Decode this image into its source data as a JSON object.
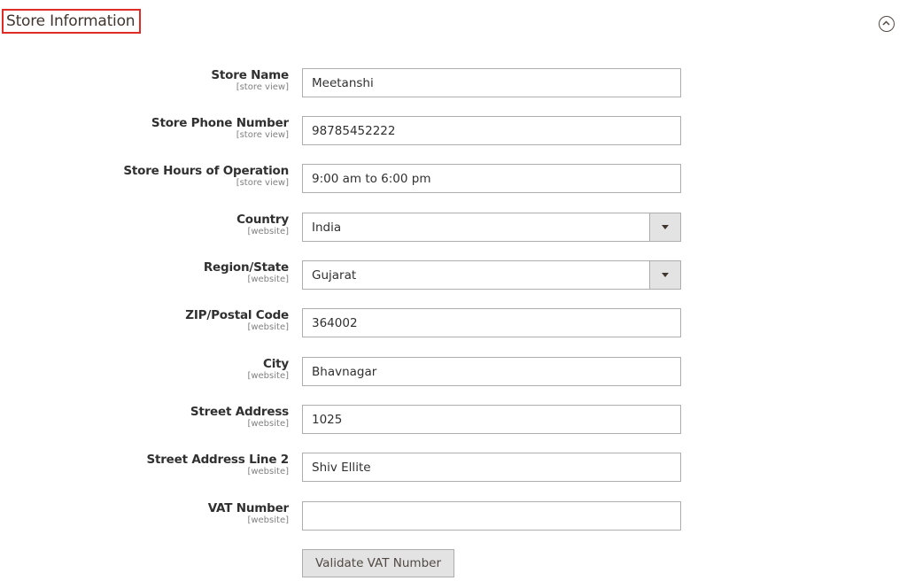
{
  "section": {
    "title": "Store Information",
    "collapse_icon": "chevron-up-circle-icon"
  },
  "fields": [
    {
      "label": "Store Name",
      "scope": "[store view]",
      "type": "text",
      "value": "Meetanshi"
    },
    {
      "label": "Store Phone Number",
      "scope": "[store view]",
      "type": "text",
      "value": "98785452222"
    },
    {
      "label": "Store Hours of Operation",
      "scope": "[store view]",
      "type": "text",
      "value": "9:00 am to 6:00 pm"
    },
    {
      "label": "Country",
      "scope": "[website]",
      "type": "select",
      "value": "India"
    },
    {
      "label": "Region/State",
      "scope": "[website]",
      "type": "select",
      "value": "Gujarat"
    },
    {
      "label": "ZIP/Postal Code",
      "scope": "[website]",
      "type": "text",
      "value": "364002"
    },
    {
      "label": "City",
      "scope": "[website]",
      "type": "text",
      "value": "Bhavnagar"
    },
    {
      "label": "Street Address",
      "scope": "[website]",
      "type": "text",
      "value": "1025"
    },
    {
      "label": "Street Address Line 2",
      "scope": "[website]",
      "type": "text",
      "value": "Shiv Ellite"
    },
    {
      "label": "VAT Number",
      "scope": "[website]",
      "type": "text",
      "value": ""
    }
  ],
  "validate_button": {
    "label": "Validate VAT Number"
  }
}
